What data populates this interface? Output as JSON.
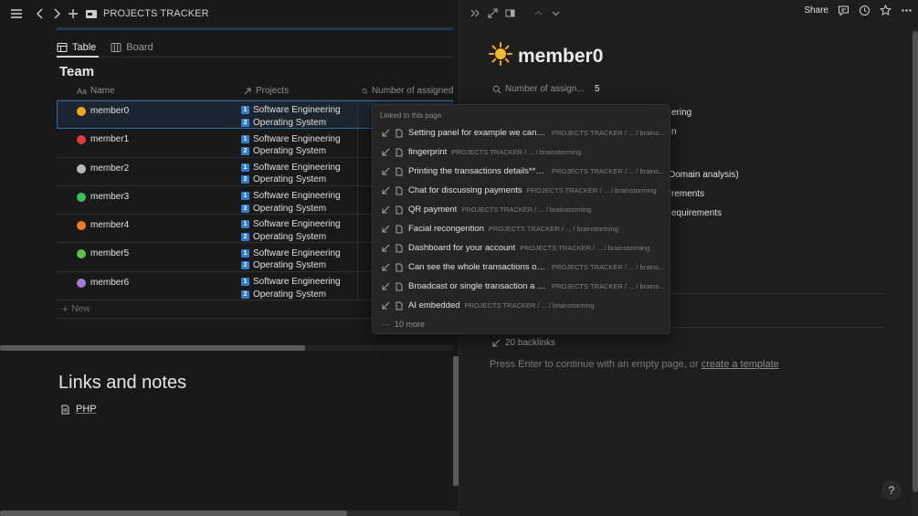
{
  "topbar": {
    "title": "PROJECTS TRACKER"
  },
  "views": [
    {
      "label": "Table",
      "icon": "table-icon",
      "active": true
    },
    {
      "label": "Board",
      "icon": "board-icon",
      "active": false
    }
  ],
  "database": {
    "title": "Team",
    "columns": {
      "name": "Name",
      "projects": "Projects",
      "number": "Number of assigned t"
    },
    "rows": [
      {
        "name": "member0",
        "icon": "sun-icon",
        "icon_color": "#f5a623",
        "projects": [
          "Software Engineering",
          "Operating System"
        ]
      },
      {
        "name": "member1",
        "icon": "red-circle-icon",
        "icon_color": "#e03b3b",
        "projects": [
          "Software Engineering",
          "Operating System"
        ]
      },
      {
        "name": "member2",
        "icon": "dog-icon",
        "icon_color": "#b9b9b9",
        "projects": [
          "Software Engineering",
          "Operating System"
        ]
      },
      {
        "name": "member3",
        "icon": "clover-icon",
        "icon_color": "#3dbd5c",
        "projects": [
          "Software Engineering",
          "Operating System"
        ]
      },
      {
        "name": "member4",
        "icon": "fox-icon",
        "icon_color": "#f07a2a",
        "projects": [
          "Software Engineering",
          "Operating System"
        ]
      },
      {
        "name": "member5",
        "icon": "green-circle-icon",
        "icon_color": "#5fbf4a",
        "projects": [
          "Software Engineering",
          "Operating System"
        ]
      },
      {
        "name": "member6",
        "icon": "purple-circle-icon",
        "icon_color": "#a77bd6",
        "projects": [
          "Software Engineering",
          "Operating System"
        ]
      }
    ],
    "new_label": "New"
  },
  "links": {
    "title": "Links and notes",
    "item": "PHP"
  },
  "right": {
    "share": "Share",
    "page_title": "member0",
    "property": {
      "label": "Number of assign...",
      "value": "5"
    },
    "fragments": [
      "ering",
      "n",
      "Domain analysis)",
      "rements",
      "equirements"
    ],
    "backlinks": "20 backlinks",
    "press_enter": "Press Enter to continue with an empty page, or ",
    "create_template": "create a template",
    "help": "?"
  },
  "popup": {
    "header": "Linked to this page",
    "items": [
      {
        "title": "Setting panel for example we can t...",
        "path": "PROJECTS TRACKER / ... / brains..."
      },
      {
        "title": "fingerprint",
        "path": "PROJECTS TRACKER / ... / brainstorming"
      },
      {
        "title": "Printing the transactions details**p...",
        "path": "PROJECTS TRACKER / ... / brains..."
      },
      {
        "title": "Chat for discussing payments",
        "path": "PROJECTS TRACKER / ... / brainstorming"
      },
      {
        "title": "QR payment",
        "path": "PROJECTS TRACKER / ... / brainstorming"
      },
      {
        "title": "Facial recongention",
        "path": "PROJECTS TRACKER / ... / brainstorming"
      },
      {
        "title": "Dashboard for your account",
        "path": "PROJECTS TRACKER / ... / brainstorming"
      },
      {
        "title": "Can see the whole transactions ov...",
        "path": "PROJECTS TRACKER / ... / brains..."
      },
      {
        "title": "Broadcast or single transaction a ti...",
        "path": "PROJECTS TRACKER / ... / brains..."
      },
      {
        "title": "AI embedded",
        "path": "PROJECTS TRACKER / ... / brainstorming"
      }
    ],
    "more": "10 more"
  }
}
